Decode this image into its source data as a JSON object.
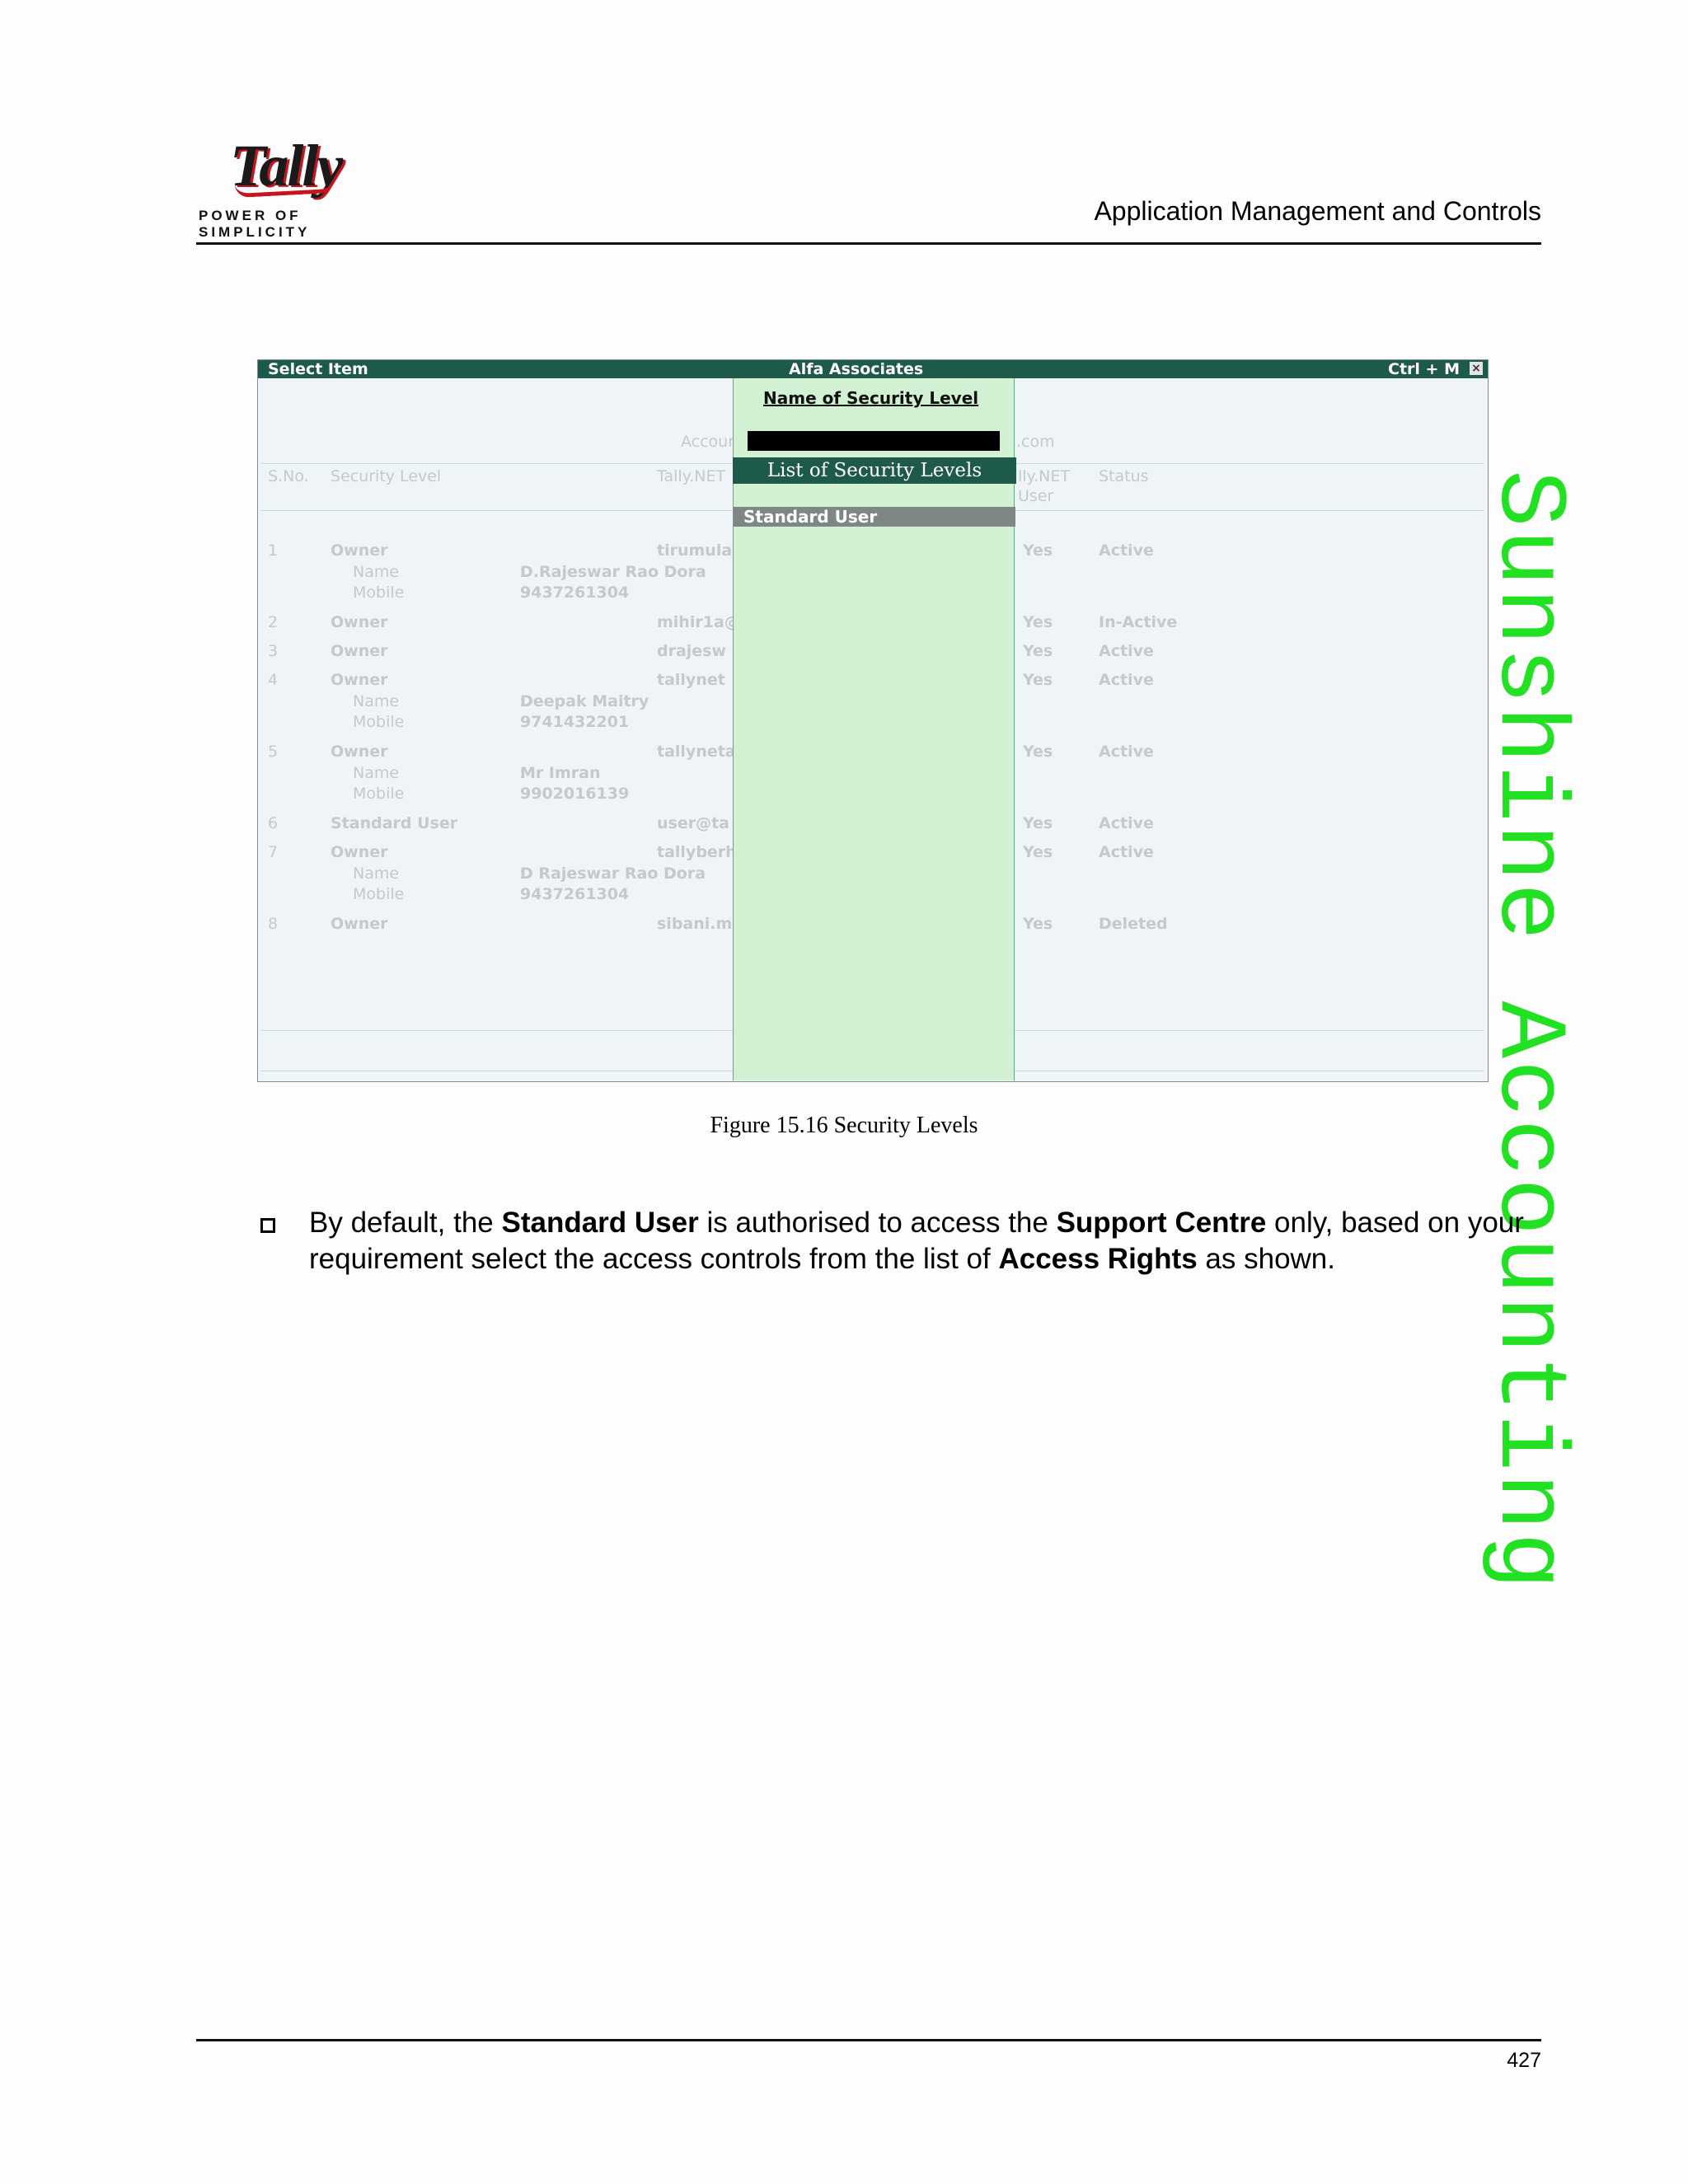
{
  "header": {
    "logo_text": "Tally",
    "tagline": "POWER OF SIMPLICITY",
    "section_title": "Application Management and Controls"
  },
  "watermark": "Sunshine Accounting",
  "screenshot": {
    "titlebar": {
      "left": "Select Item",
      "center": "Alfa Associates",
      "right": "Ctrl + M",
      "close": "×"
    },
    "background_columns": {
      "account_left": "Accoun",
      "account_right": ".com",
      "headers": [
        "S.No.",
        "Security Level",
        "Tally.NET",
        "lly.NET",
        "User",
        "Status"
      ]
    },
    "rows": [
      {
        "sno": "1",
        "level": "Owner",
        "email": "tirumula",
        "user": "Yes",
        "status": "Active",
        "name": "D.Rajeswar Rao Dora",
        "mobile": "9437261304"
      },
      {
        "sno": "2",
        "level": "Owner",
        "email": "mihir1a@",
        "user": "Yes",
        "status": "In-Active"
      },
      {
        "sno": "3",
        "level": "Owner",
        "email": "drajesw",
        "user": "Yes",
        "status": "Active"
      },
      {
        "sno": "4",
        "level": "Owner",
        "email": "tallynet",
        "user": "Yes",
        "status": "Active",
        "name": "Deepak Maitry",
        "mobile": "9741432201"
      },
      {
        "sno": "5",
        "level": "Owner",
        "email": "tallyneta",
        "user": "Yes",
        "status": "Active",
        "name": "Mr Imran",
        "mobile": "9902016139"
      },
      {
        "sno": "6",
        "level": "Standard User",
        "email": "user@ta",
        "user": "Yes",
        "status": "Active"
      },
      {
        "sno": "7",
        "level": "Owner",
        "email": "tallyberh",
        "user": "Yes",
        "status": "Active",
        "name": "D Rajeswar Rao Dora",
        "mobile": "9437261304"
      },
      {
        "sno": "8",
        "level": "Owner",
        "email": "sibani.m",
        "user": "Yes",
        "status": "Deleted"
      }
    ],
    "sub_labels": {
      "name": "Name",
      "mobile": "Mobile",
      "sep": ":"
    },
    "panel": {
      "title": "Name of Security Level",
      "list_title": "List of Security Levels",
      "items": [
        "Standard User"
      ]
    }
  },
  "caption": "Figure 15.16  Security Levels",
  "body": {
    "p1": "By default, the ",
    "b1": "Standard User",
    "p2": " is authorised to access the ",
    "b2": "Support Centre",
    "p3": " only, based on your requirement select the access controls from the list of ",
    "b3": "Access Rights",
    "p4": " as shown."
  },
  "page_number": "427"
}
